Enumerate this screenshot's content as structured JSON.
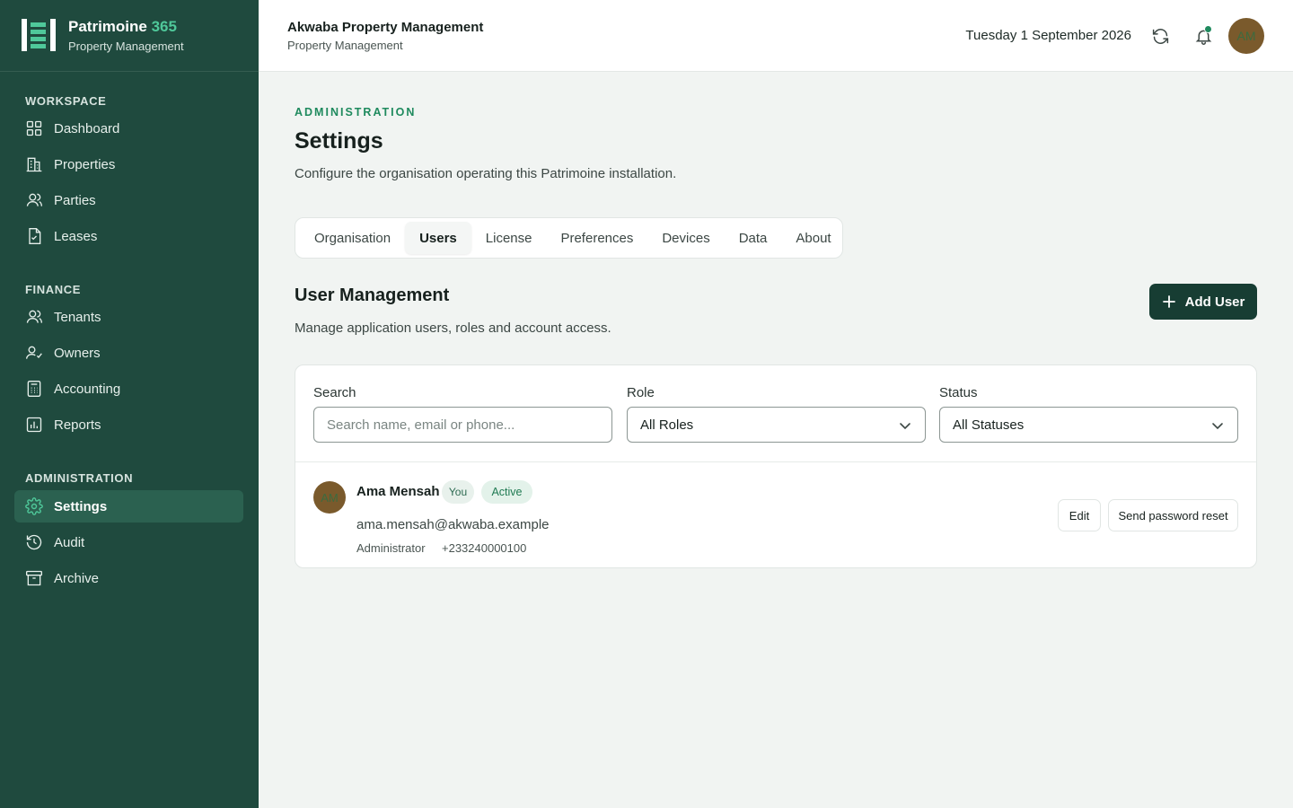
{
  "brand": {
    "name": "Patrimoine",
    "name_suffix": "365",
    "subtitle": "Property Management"
  },
  "sidebar": {
    "sections": [
      {
        "heading": "WORKSPACE",
        "items": [
          {
            "label": "Dashboard",
            "icon": "grid-icon"
          },
          {
            "label": "Properties",
            "icon": "building-icon"
          },
          {
            "label": "Parties",
            "icon": "users-icon"
          },
          {
            "label": "Leases",
            "icon": "document-icon"
          }
        ]
      },
      {
        "heading": "FINANCE",
        "items": [
          {
            "label": "Tenants",
            "icon": "users-icon"
          },
          {
            "label": "Owners",
            "icon": "user-check-icon"
          },
          {
            "label": "Accounting",
            "icon": "calculator-icon"
          },
          {
            "label": "Reports",
            "icon": "bar-chart-icon"
          }
        ]
      },
      {
        "heading": "ADMINISTRATION",
        "items": [
          {
            "label": "Settings",
            "icon": "gear-icon",
            "active": true
          },
          {
            "label": "Audit",
            "icon": "history-icon"
          },
          {
            "label": "Archive",
            "icon": "archive-icon"
          }
        ]
      }
    ]
  },
  "header": {
    "org_name": "Akwaba Property Management",
    "org_subtitle": "Property Management",
    "date": "Tuesday 1 September 2026",
    "user_initials": "AM"
  },
  "page": {
    "eyebrow": "ADMINISTRATION",
    "title": "Settings",
    "description": "Configure the organisation operating this Patrimoine installation."
  },
  "tabs": [
    {
      "label": "Organisation"
    },
    {
      "label": "Users",
      "active": true
    },
    {
      "label": "License"
    },
    {
      "label": "Preferences"
    },
    {
      "label": "Devices"
    },
    {
      "label": "Data"
    },
    {
      "label": "About"
    }
  ],
  "user_management": {
    "title": "User Management",
    "description": "Manage application users, roles and account access.",
    "add_button": "Add User",
    "filters": {
      "search_label": "Search",
      "search_placeholder": "Search name, email or phone...",
      "role_label": "Role",
      "role_value": "All Roles",
      "status_label": "Status",
      "status_value": "All Statuses"
    },
    "users": [
      {
        "initials": "AM",
        "name": "Ama Mensah",
        "you_badge": "You",
        "status": "Active",
        "email": "ama.mensah@akwaba.example",
        "role": "Administrator",
        "phone": "+233240000100",
        "edit_label": "Edit",
        "reset_label": "Send password reset"
      }
    ]
  },
  "colors": {
    "sidebar_bg": "#1f4a3e",
    "sidebar_active": "#2b6150",
    "accent": "#4fc89a",
    "primary_button": "#173d33",
    "eyebrow": "#1f8a5e",
    "avatar_bg": "#7a5a2c"
  }
}
